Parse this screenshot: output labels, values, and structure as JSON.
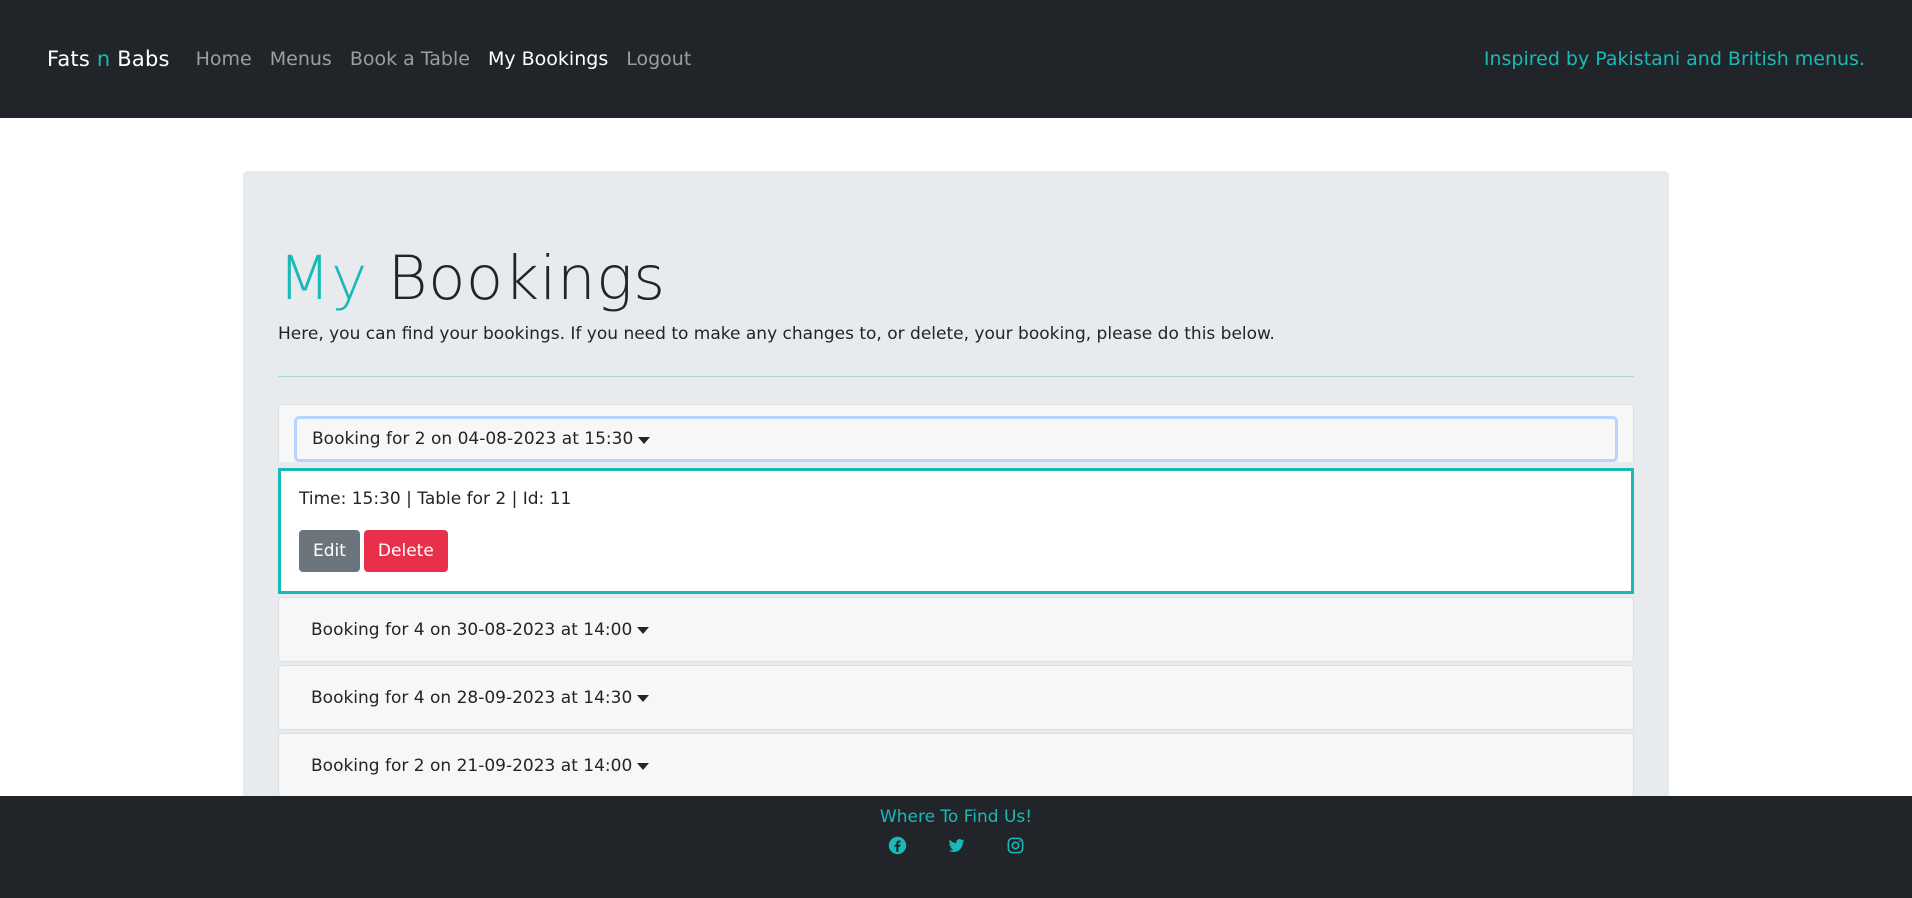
{
  "navbar": {
    "brand_part1": "Fats ",
    "brand_accent": "n",
    "brand_part2": " Babs",
    "links": [
      {
        "label": "Home"
      },
      {
        "label": "Menus"
      },
      {
        "label": "Book a Table"
      },
      {
        "label": "My Bookings",
        "active": true
      },
      {
        "label": "Logout"
      }
    ],
    "tagline": "Inspired by Pakistani and British menus."
  },
  "main": {
    "title_accent": "My",
    "title_rest": " Bookings",
    "intro": "Here, you can find your bookings. If you need to make any changes to, or delete, your booking, please do this below.",
    "bookings": [
      {
        "header": "Booking for 2 on 04-08-2023 at 15:30",
        "expanded": true,
        "detail": "Time: 15:30 | Table for 2 | Id: 11",
        "edit_label": "Edit",
        "delete_label": "Delete"
      },
      {
        "header": "Booking for 4 on 30-08-2023 at 14:00",
        "expanded": false
      },
      {
        "header": "Booking for 4 on 28-09-2023 at 14:30",
        "expanded": false
      },
      {
        "header": "Booking for 2 on 21-09-2023 at 14:00",
        "expanded": false
      }
    ]
  },
  "footer": {
    "title": "Where To Find Us!",
    "socials": [
      "facebook-icon",
      "twitter-icon",
      "instagram-icon"
    ]
  },
  "colors": {
    "accent": "#1ab9b7",
    "dark": "#212529",
    "panel": "#e8ebee",
    "edit": "#6c757d",
    "delete": "#e8304a"
  }
}
